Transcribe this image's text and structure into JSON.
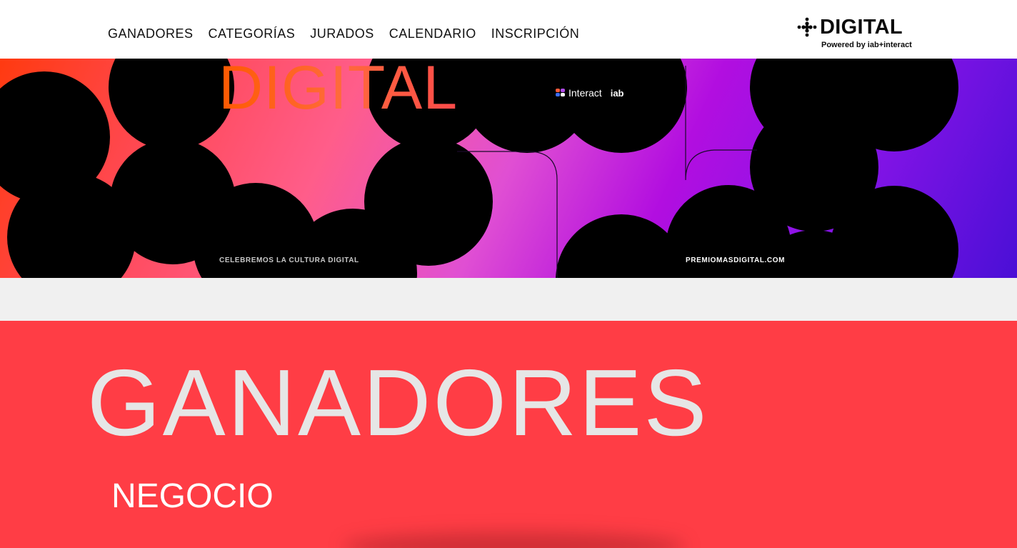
{
  "nav": {
    "items": [
      {
        "label": "GANADORES"
      },
      {
        "label": "CATEGORÍAS"
      },
      {
        "label": "JURADOS"
      },
      {
        "label": "CALENDARIO"
      },
      {
        "label": "INSCRIPCIÓN"
      }
    ]
  },
  "logo": {
    "word": "DIGITAL",
    "subtitle": "Powered by iab+interact"
  },
  "banner": {
    "title": "DIGITAL",
    "partner_interact": "Interact",
    "partner_iab": "iab",
    "tagline": "CELEBREMOS LA CULTURA DIGITAL",
    "url": "PREMIOMASDIGITAL.COM"
  },
  "winners": {
    "title": "GANADORES",
    "category": "NEGOCIO"
  },
  "colors": {
    "winners_bg": "#ff3d45",
    "strip_bg": "#f0f0f0",
    "header_bg": "#ffffff"
  }
}
